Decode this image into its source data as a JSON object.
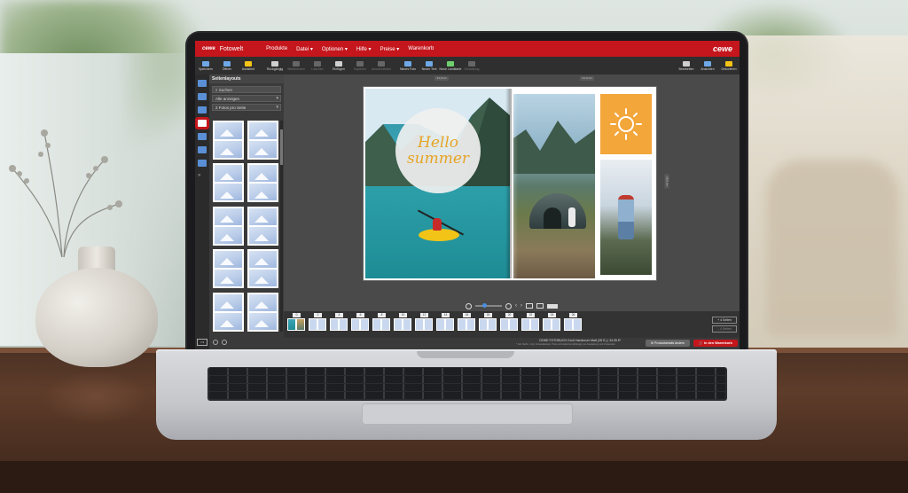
{
  "app": {
    "brand": "cewe",
    "name": "Fotowelt",
    "brand_right": "cewe"
  },
  "menu": [
    "Produkte",
    "Datei ▾",
    "Optionen ▾",
    "Hilfe ▾",
    "Preise ▾",
    "Warenkorb"
  ],
  "toolbar": {
    "left": [
      {
        "label": "Speichern",
        "icon": "save-icon",
        "color": "#6fa8e6"
      },
      {
        "label": "Öffnen",
        "icon": "folder-icon",
        "color": "#6fa8e6"
      },
      {
        "label": "Assistent",
        "icon": "wizard-icon",
        "color": "#f2c417"
      },
      {
        "label": "Rückgängig",
        "icon": "undo-icon",
        "color": "#cfcfcf"
      },
      {
        "label": "Wiederholen",
        "icon": "redo-icon",
        "color": "#777",
        "dim": true
      },
      {
        "label": "Löschen",
        "icon": "delete-icon",
        "color": "#777",
        "dim": true
      },
      {
        "label": "Einfügen",
        "icon": "paste-icon",
        "color": "#cfcfcf"
      },
      {
        "label": "Kopieren",
        "icon": "copy-icon",
        "color": "#777",
        "dim": true
      },
      {
        "label": "Ausschneiden",
        "icon": "cut-icon",
        "color": "#777",
        "dim": true
      },
      {
        "label": "Neues Foto",
        "icon": "photo-icon",
        "color": "#6fa8e6"
      },
      {
        "label": "Neuer Text",
        "icon": "text-icon",
        "color": "#6fa8e6"
      },
      {
        "label": "Neue Landkarte",
        "icon": "map-icon",
        "color": "#6fce6f"
      },
      {
        "label": "Gestaltung",
        "icon": "design-icon",
        "color": "#777",
        "dim": true
      }
    ],
    "right": [
      {
        "label": "Bearbeiten",
        "icon": "edit-icon",
        "color": "#cfcfcf"
      },
      {
        "label": "Ansichten",
        "icon": "view-icon",
        "color": "#6fa8e6"
      },
      {
        "label": "Dekorieren",
        "icon": "decorate-icon",
        "color": "#f2c417"
      }
    ]
  },
  "panel": {
    "title": "Seitenlayouts",
    "search_placeholder": "Suchen",
    "filter_value": "Alle anzeigen",
    "photos_value": "2 Fotos pro Seite",
    "layout_count": 10
  },
  "spread": {
    "hello_line1": "Hello",
    "hello_line2": "summer",
    "ruler_top_left": "21,0 cm",
    "ruler_top_right": "21,0 cm",
    "ruler_side": "28,0 cm"
  },
  "pagestrip": {
    "pages": [
      "0",
      "2",
      "4",
      "6",
      "8",
      "10",
      "12",
      "14",
      "16",
      "18",
      "20",
      "22",
      "24",
      "26"
    ],
    "add_pages_label": "+ 4 Seiten",
    "remove_pages_label": "– 4 Seiten"
  },
  "status": {
    "product": "CEWE FOTOBUCH Groß Hardcover Matt (28 S.) | 34,95 €*",
    "note": "* inkl. MwSt., zzgl. Versandkosten. Preis und Lieferzeit abhängig von Ausstattung und Versandart.",
    "details_label": "Produktdetails ändern",
    "cart_label": "In den Warenkorb"
  },
  "colors": {
    "brand_red": "#c4161c",
    "sun_orange": "#f3a63a",
    "hello_gold": "#e7a425"
  }
}
